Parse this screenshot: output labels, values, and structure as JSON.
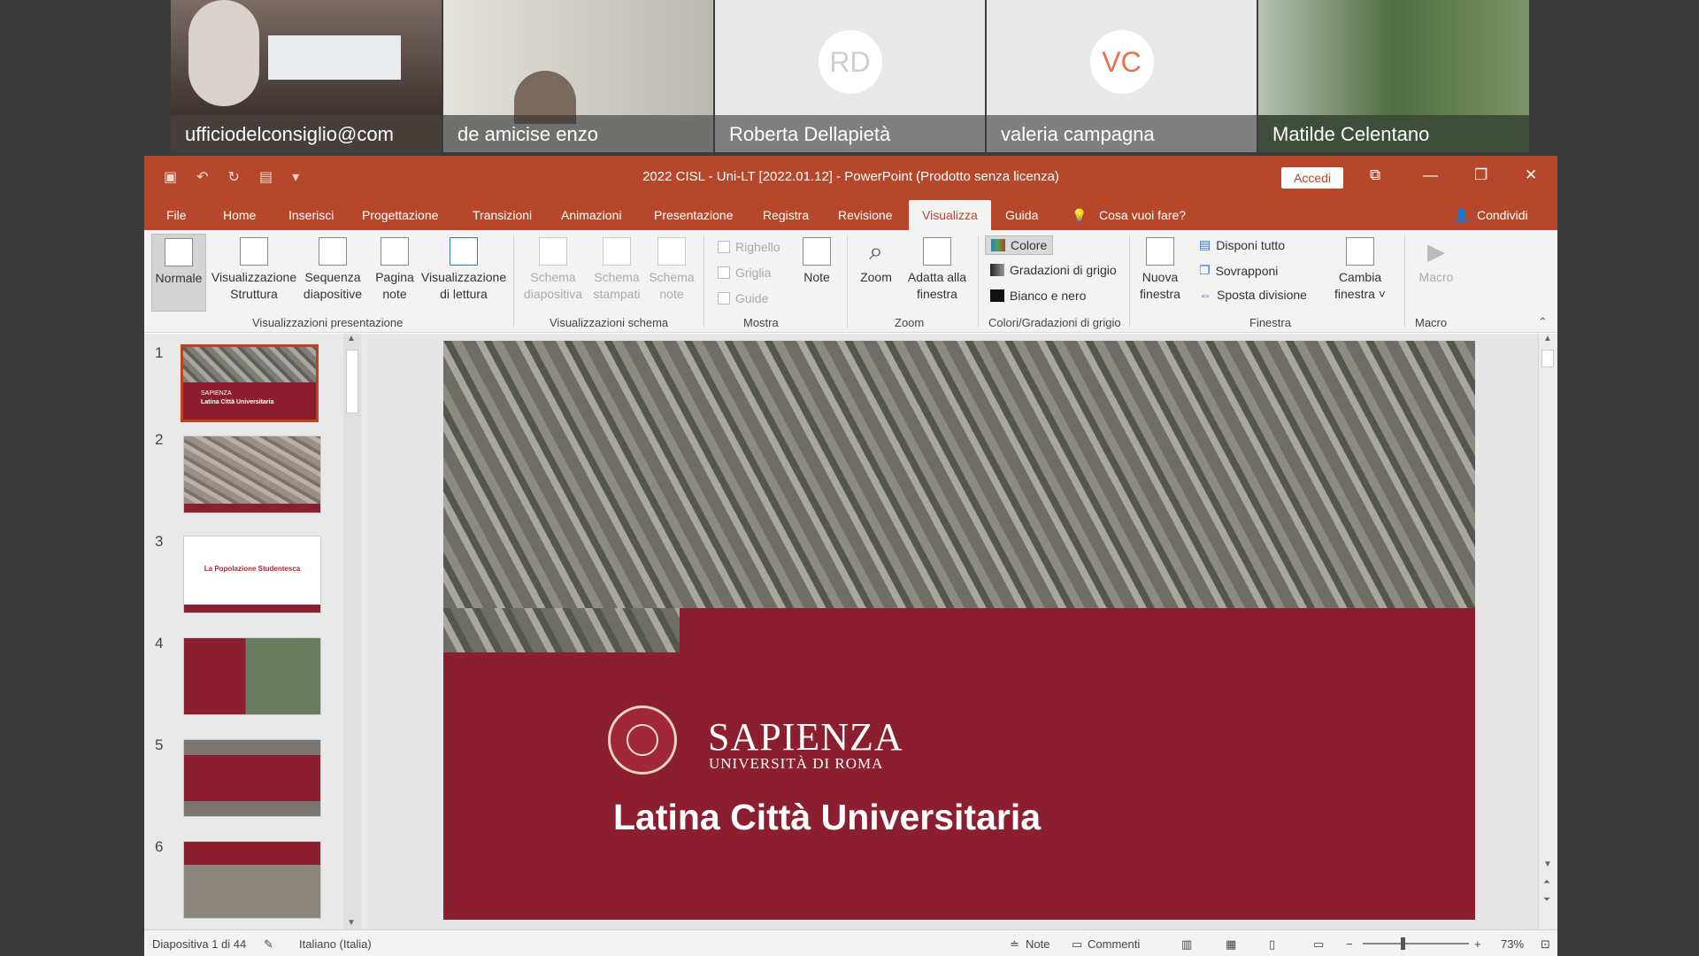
{
  "meeting": {
    "participants": [
      {
        "name": "ufficiodelconsiglio@com",
        "initials": ""
      },
      {
        "name": "de amicise enzo",
        "initials": ""
      },
      {
        "name": "Roberta Dellapietà",
        "initials": "RD",
        "initials_color": "#cfcfcf"
      },
      {
        "name": "valeria campagna",
        "initials": "VC",
        "initials_color": "#e8704f"
      },
      {
        "name": "Matilde Celentano",
        "initials": ""
      }
    ]
  },
  "window": {
    "title": "2022 CISL - Uni-LT [2022.01.12]  -  PowerPoint (Prodotto senza licenza)",
    "signin": "Accedi",
    "controls": {
      "ribbon_display": "⧉",
      "minimize": "—",
      "restore": "❐",
      "close": "✕"
    },
    "accent": "#b7472a"
  },
  "menu": {
    "items": [
      "File",
      "Home",
      "Inserisci",
      "Progettazione",
      "Transizioni",
      "Animazioni",
      "Presentazione",
      "Registra",
      "Revisione",
      "Visualizza",
      "Guida"
    ],
    "active": "Visualizza",
    "tell_me": "Cosa vuoi fare?",
    "share": "Condividi"
  },
  "ribbon": {
    "groups": {
      "presentation_views": "Visualizzazioni presentazione",
      "master_views": "Visualizzazioni schema",
      "show": "Mostra",
      "zoom": "Zoom",
      "color": "Colori/Gradazioni di grigio",
      "window": "Finestra",
      "macro": "Macro"
    },
    "buttons": {
      "normal": "Normale",
      "outline_1": "Visualizzazione",
      "outline_2": "Struttura",
      "sorter_1": "Sequenza",
      "sorter_2": "diapositive",
      "notes_page_1": "Pagina",
      "notes_page_2": "note",
      "reading_1": "Visualizzazione",
      "reading_2": "di lettura",
      "slide_master_1": "Schema",
      "slide_master_2": "diapositiva",
      "handout_master_1": "Schema",
      "handout_master_2": "stampati",
      "notes_master_1": "Schema",
      "notes_master_2": "note",
      "ruler": "Righello",
      "gridlines": "Griglia",
      "guides": "Guide",
      "notes": "Note",
      "zoom": "Zoom",
      "fit_1": "Adatta alla",
      "fit_2": "finestra",
      "color": "Colore",
      "grayscale": "Gradazioni di grigio",
      "bw": "Bianco e nero",
      "new_window_1": "Nuova",
      "new_window_2": "finestra",
      "arrange_all": "Disponi tutto",
      "cascade": "Sovrapponi",
      "move_split": "Sposta divisione",
      "switch_1": "Cambia",
      "switch_2": "finestra ˅",
      "macro": "Macro"
    }
  },
  "thumbnails": {
    "numbers": [
      "1",
      "2",
      "3",
      "4",
      "5",
      "6"
    ],
    "slide3_title": "La Popolazione Studentesca",
    "slide1_brand": "SAPIENZA",
    "slide1_title": "Latina Città Universitaria"
  },
  "slide": {
    "brand": "SAPIENZA",
    "brand_sub": "UNIVERSITÀ DI ROMA",
    "title": "Latina Città Universitaria",
    "bg_color": "#8b1e2f"
  },
  "status": {
    "slide_info": "Diapositiva 1 di 44",
    "language": "Italiano (Italia)",
    "notes": "Note",
    "comments": "Commenti",
    "zoom": "73%"
  }
}
